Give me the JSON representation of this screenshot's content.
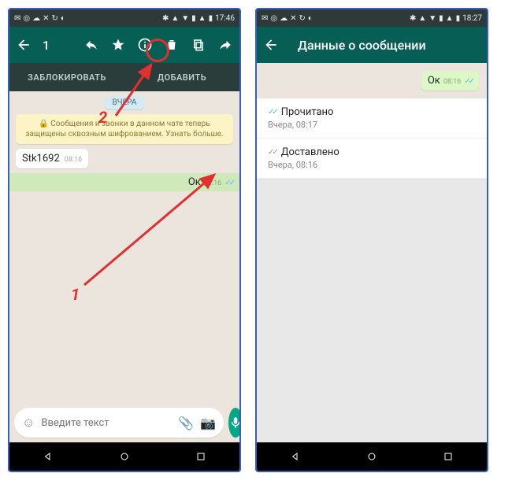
{
  "left": {
    "statusbar": {
      "time": "17:46"
    },
    "header": {
      "count": "1"
    },
    "tabs": {
      "block": "ЗАБЛОКИРОВАТЬ",
      "add": "ДОБАВИТЬ"
    },
    "chat": {
      "date": "ВЧЕРА",
      "encryption": "🔒 Сообщения и звонки в данном чате теперь защищены сквозным шифрованием. Узнать больше.",
      "in_msg": "Stk1692",
      "in_time": "08:16",
      "out_msg": "Ок",
      "out_time": "08:16"
    },
    "input": {
      "placeholder": "Введите текст"
    },
    "callouts": {
      "one": "1",
      "two": "2"
    }
  },
  "right": {
    "statusbar": {
      "time": "18:27"
    },
    "header": {
      "title": "Данные о сообщении"
    },
    "bubble": {
      "msg": "Ок",
      "time": "08:16"
    },
    "read": {
      "label": "Прочитано",
      "sub": "Вчера, 08:17"
    },
    "delivered": {
      "label": "Доставлено",
      "sub": "Вчера, 08:16"
    }
  }
}
